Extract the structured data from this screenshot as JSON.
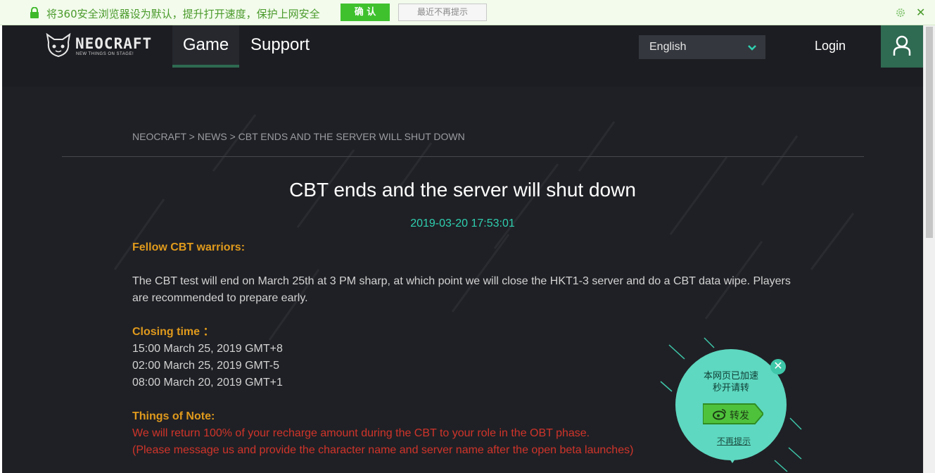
{
  "browser_notice": {
    "message": "将360安全浏览器设为默认，提升打开速度，保护上网安全",
    "confirm_label": "确 认",
    "dismiss_label": "最近不再提示",
    "close_glyph": "✕"
  },
  "header": {
    "logo_text": "NEOCRAFT",
    "logo_tagline": "NEW THINGS ON STAGE!",
    "nav": [
      {
        "label": "Game",
        "active": true
      },
      {
        "label": "Support",
        "active": false
      }
    ],
    "language": "English",
    "login_label": "Login",
    "icons": [
      "user-icon",
      "chevron-down-icon"
    ]
  },
  "article": {
    "breadcrumb": "NEOCRAFT > NEWS > CBT ENDS AND THE SERVER WILL SHUT DOWN",
    "title": "CBT ends and the server will shut down",
    "date": "2019-03-20 17:53:01",
    "greeting": "Fellow CBT warriors:",
    "intro": "The CBT test will end on March 25th at 3 PM sharp, at which point we will close the HKT1-3 server and do a CBT data wipe. Players are recommended to prepare early.",
    "closing_heading": "Closing time ：",
    "closing_times": [
      "15:00 March 25, 2019 GMT+8",
      "02:00 March 25, 2019 GMT-5",
      "08:00 March 20, 2019 GMT+1"
    ],
    "note_heading": "Things of Note:",
    "note_lines": [
      "We will return 100% of your recharge amount during the CBT to your role in the OBT phase.",
      "(Please message us and provide the character name and server name after the open beta launches)"
    ]
  },
  "accelerate_bubble": {
    "line1": "本网页已加速",
    "line2": "秒开请转",
    "share_label": "转发",
    "no_prompt_label": "不再提示",
    "close_glyph": "✕"
  },
  "colors": {
    "accent_green": "#2f6a52",
    "date_teal": "#2fd0b0",
    "heading_orange": "#e09a1c",
    "note_red": "#d0342a",
    "bubble_teal": "#5ed8c0",
    "notice_green": "#3fc12e"
  }
}
